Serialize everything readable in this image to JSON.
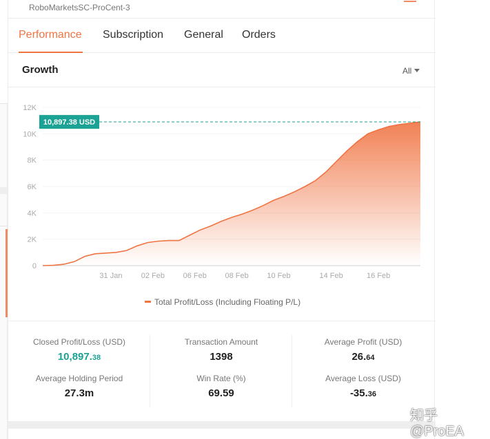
{
  "account": {
    "name": "RoboMarketsSC-ProCent-3"
  },
  "tabs": [
    {
      "label": "Performance",
      "active": true
    },
    {
      "label": "Subscription",
      "active": false
    },
    {
      "label": "General",
      "active": false
    },
    {
      "label": "Orders",
      "active": false
    }
  ],
  "growth": {
    "title": "Growth",
    "range": "All"
  },
  "chart_data": {
    "type": "area",
    "title": "",
    "xlabel": "",
    "ylabel": "",
    "ylim": [
      0,
      12000
    ],
    "yticks": [
      0,
      2000,
      4000,
      6000,
      8000,
      10000,
      12000
    ],
    "ytick_labels": [
      "0",
      "2K",
      "4K",
      "6K",
      "8K",
      "10K",
      "12K"
    ],
    "xticks": [
      "31 Jan",
      "02 Feb",
      "06 Feb",
      "08 Feb",
      "10 Feb",
      "14 Feb",
      "16 Feb"
    ],
    "grid": true,
    "legend": "bottom-center",
    "highlight": {
      "value": 10897.38,
      "label": "10,897.38 USD"
    },
    "series": [
      {
        "name": "Total Profit/Loss (Including Floating P/L)",
        "color": "#f07342",
        "x": [
          -1.0,
          -0.5,
          0.0,
          0.5,
          1.0,
          1.5,
          2.0,
          2.5,
          3.0,
          3.5,
          4.0,
          4.5,
          5.0,
          5.5,
          6.0,
          6.5,
          7.0,
          7.5,
          8.0,
          8.5,
          9.0,
          9.5,
          10.0,
          10.5,
          11.0,
          11.5,
          12.0,
          12.5,
          13.0,
          13.5,
          14.0,
          14.5,
          15.0,
          15.5,
          16.0,
          16.5,
          17.0
        ],
        "values": [
          0,
          20,
          100,
          300,
          700,
          900,
          950,
          1000,
          1150,
          1500,
          1750,
          1850,
          1900,
          1900,
          2300,
          2700,
          3000,
          3350,
          3650,
          3900,
          4200,
          4550,
          4950,
          5250,
          5600,
          6000,
          6450,
          7100,
          7900,
          8700,
          9400,
          10000,
          10300,
          10550,
          10700,
          10800,
          10897
        ]
      }
    ]
  },
  "stats": [
    {
      "label": "Closed Profit/Loss (USD)",
      "value_main": "10,897.",
      "value_small": "38",
      "green": true
    },
    {
      "label": "Transaction Amount",
      "value_main": "1398",
      "value_small": ""
    },
    {
      "label": "Average Profit (USD)",
      "value_main": "26.",
      "value_small": "64"
    },
    {
      "label": "Average Holding Period",
      "value_main": "27.3m",
      "value_small": ""
    },
    {
      "label": "Win Rate (%)",
      "value_main": "69.59",
      "value_small": ""
    },
    {
      "label": "Average Loss (USD)",
      "value_main": "-35.",
      "value_small": "36"
    }
  ],
  "watermark": "知乎 @ProEA",
  "colors": {
    "accent": "#f07342",
    "green": "#1aa394"
  }
}
